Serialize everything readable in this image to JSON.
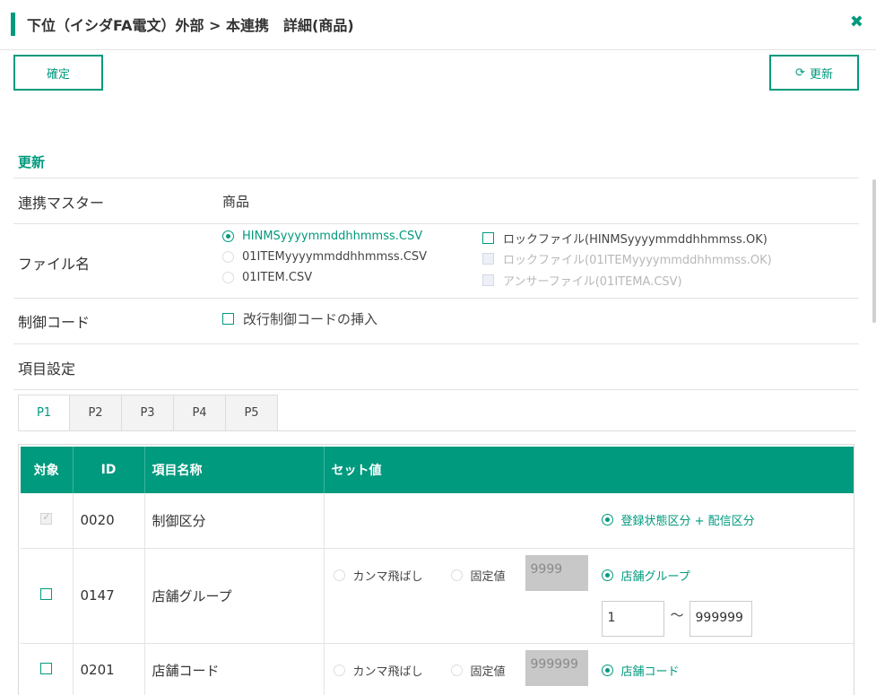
{
  "header": {
    "title": "下位（イシダFA電文）外部 > 本連携　詳細(商品)",
    "close_icon": "close-icon"
  },
  "toolbar": {
    "confirm_label": "確定",
    "refresh_label": "更新",
    "refresh_icon": "refresh-icon"
  },
  "section": {
    "title": "更新"
  },
  "form": {
    "master_label": "連携マスター",
    "master_value": "商品",
    "filename_label": "ファイル名",
    "file_options": [
      {
        "label": "HINMSyyyymmddhhmmss.CSV",
        "selected": true
      },
      {
        "label": "01ITEMyyyymmddhhmmss.CSV",
        "selected": false
      },
      {
        "label": "01ITEM.CSV",
        "selected": false
      }
    ],
    "file_checks": [
      {
        "label": "ロックファイル(HINMSyyyymmddhhmmss.OK)",
        "enabled": true
      },
      {
        "label": "ロックファイル(01ITEMyyyymmddhhmmss.OK)",
        "enabled": false
      },
      {
        "label": "アンサーファイル(01ITEMA.CSV)",
        "enabled": false
      }
    ],
    "control_label": "制御コード",
    "control_option": "改行制御コードの挿入",
    "items_label": "項目設定"
  },
  "tabs": [
    "P1",
    "P2",
    "P3",
    "P4",
    "P5"
  ],
  "table": {
    "headers": [
      "対象",
      "ID",
      "項目名称",
      "セット値"
    ],
    "rows": [
      {
        "id": "0020",
        "name": "制御区分",
        "set_option": "登録状態区分 + 配信区分"
      },
      {
        "id": "0147",
        "name": "店舗グループ",
        "opt_comma": "カンマ飛ばし",
        "opt_fixed": "固定値",
        "fixed_value": "9999",
        "set_option": "店舗グループ",
        "range_from": "1",
        "range_sep": "〜",
        "range_to": "999999"
      },
      {
        "id": "0201",
        "name": "店舗コード",
        "opt_comma": "カンマ飛ばし",
        "opt_fixed": "固定値",
        "fixed_value": "999999",
        "set_option": "店舗コード"
      }
    ]
  },
  "colors": {
    "accent": "#009a7e"
  }
}
